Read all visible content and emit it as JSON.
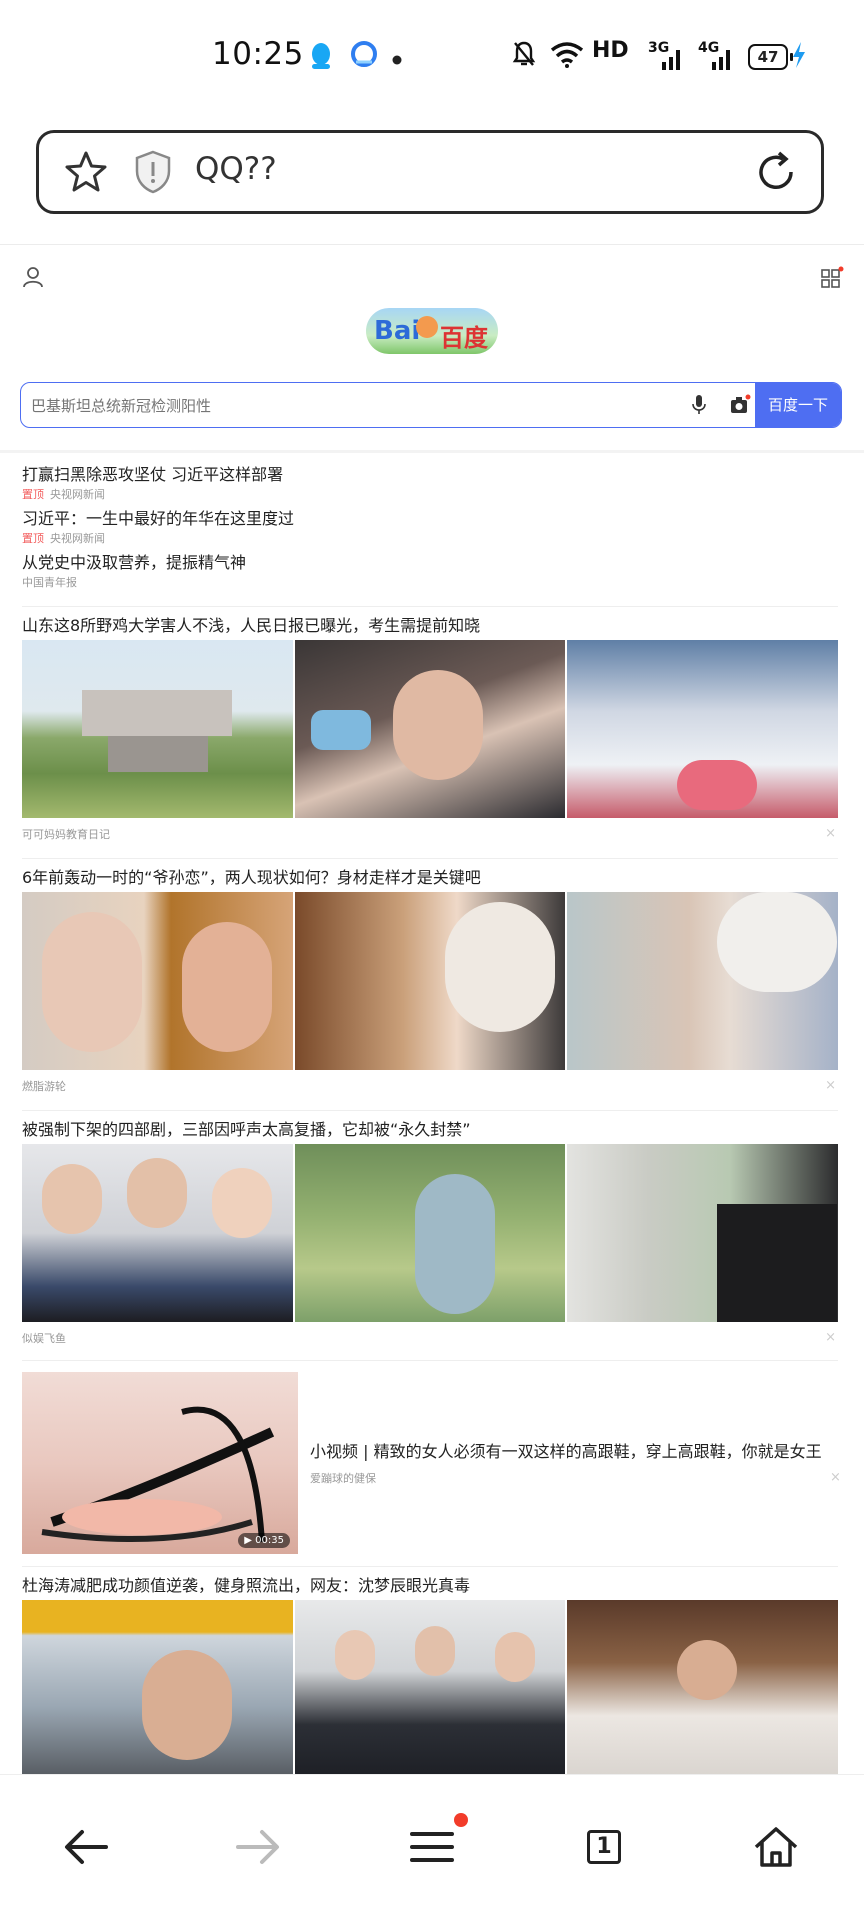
{
  "status_bar": {
    "time": "10:25",
    "network": "HD",
    "signal_1": "3G",
    "signal_2": "4G",
    "battery": "47"
  },
  "address_bar": {
    "url": "QQ??"
  },
  "baidu": {
    "logo_text_left": "Bai",
    "logo_text_right": "百度",
    "search_placeholder": "巴基斯坦总统新冠检测阳性",
    "search_button": "百度一下"
  },
  "hot_news": [
    {
      "title": "打赢扫黑除恶攻坚仗 习近平这样部署",
      "tag": "置顶",
      "source": "央视网新闻"
    },
    {
      "title": "习近平：一生中最好的年华在这里度过",
      "tag": "置顶",
      "source": "央视网新闻"
    },
    {
      "title": "从党史中汲取营养，提振精气神",
      "tag": "",
      "source": "中国青年报"
    }
  ],
  "feed": [
    {
      "title": "山东这8所野鸡大学害人不浅，人民日报已曝光，考生需提前知晓",
      "source": "可可妈妈教育日记"
    },
    {
      "title": "6年前轰动一时的“爷孙恋”，两人现状如何？身材走样才是关键吧",
      "source": "燃脂游轮"
    },
    {
      "title": "被强制下架的四部剧，三部因呼声太高复播，它却被“永久封禁”",
      "source": "似娱飞鱼"
    },
    {
      "title": "杜海涛减肥成功颜值逆袭，健身照流出，网友：沈梦辰眼光真毒",
      "source": ""
    }
  ],
  "video_item": {
    "title": "小视频 | 精致的女人必须有一双这样的高跟鞋，穿上高跟鞋，你就是女王",
    "source": "爱蹦球的健保",
    "duration": "00:35"
  },
  "feed_close": "×",
  "bottom_nav": {
    "tab_count": "1"
  }
}
